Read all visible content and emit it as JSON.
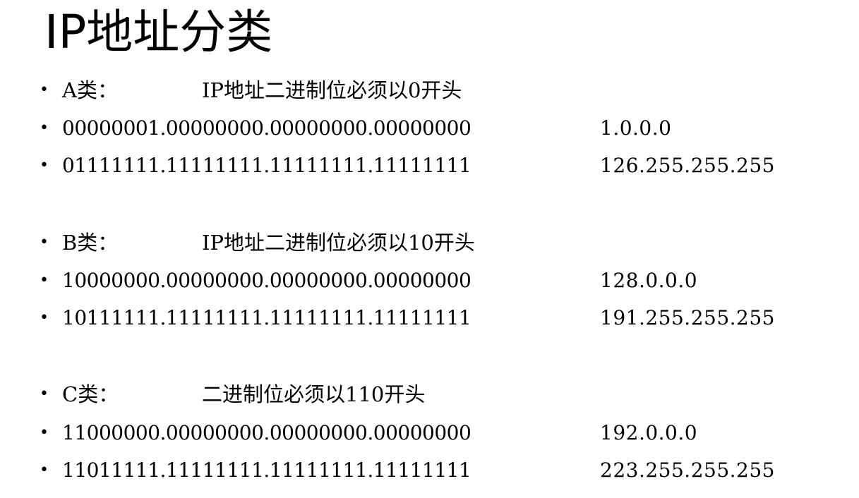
{
  "title": "IP地址分类",
  "sections": [
    {
      "class_label": "A类：",
      "rule": "IP地址二进制位必须以0开头",
      "rows": [
        {
          "binary": "00000001.00000000.00000000.00000000",
          "dotted": "1.0.0.0"
        },
        {
          "binary": "01111111.11111111.11111111.11111111",
          "dotted": "126.255.255.255"
        }
      ]
    },
    {
      "class_label": "B类：",
      "rule": "IP地址二进制位必须以10开头",
      "rows": [
        {
          "binary": "10000000.00000000.00000000.00000000",
          "dotted": "128.0.0.0"
        },
        {
          "binary": "10111111.11111111.11111111.11111111",
          "dotted": "191.255.255.255"
        }
      ]
    },
    {
      "class_label": "C类：",
      "rule": "二进制位必须以110开头",
      "rows": [
        {
          "binary": "11000000.00000000.00000000.00000000",
          "dotted": "192.0.0.0"
        },
        {
          "binary": "11011111.11111111.11111111.11111111",
          "dotted": "223.255.255.255"
        }
      ]
    }
  ]
}
